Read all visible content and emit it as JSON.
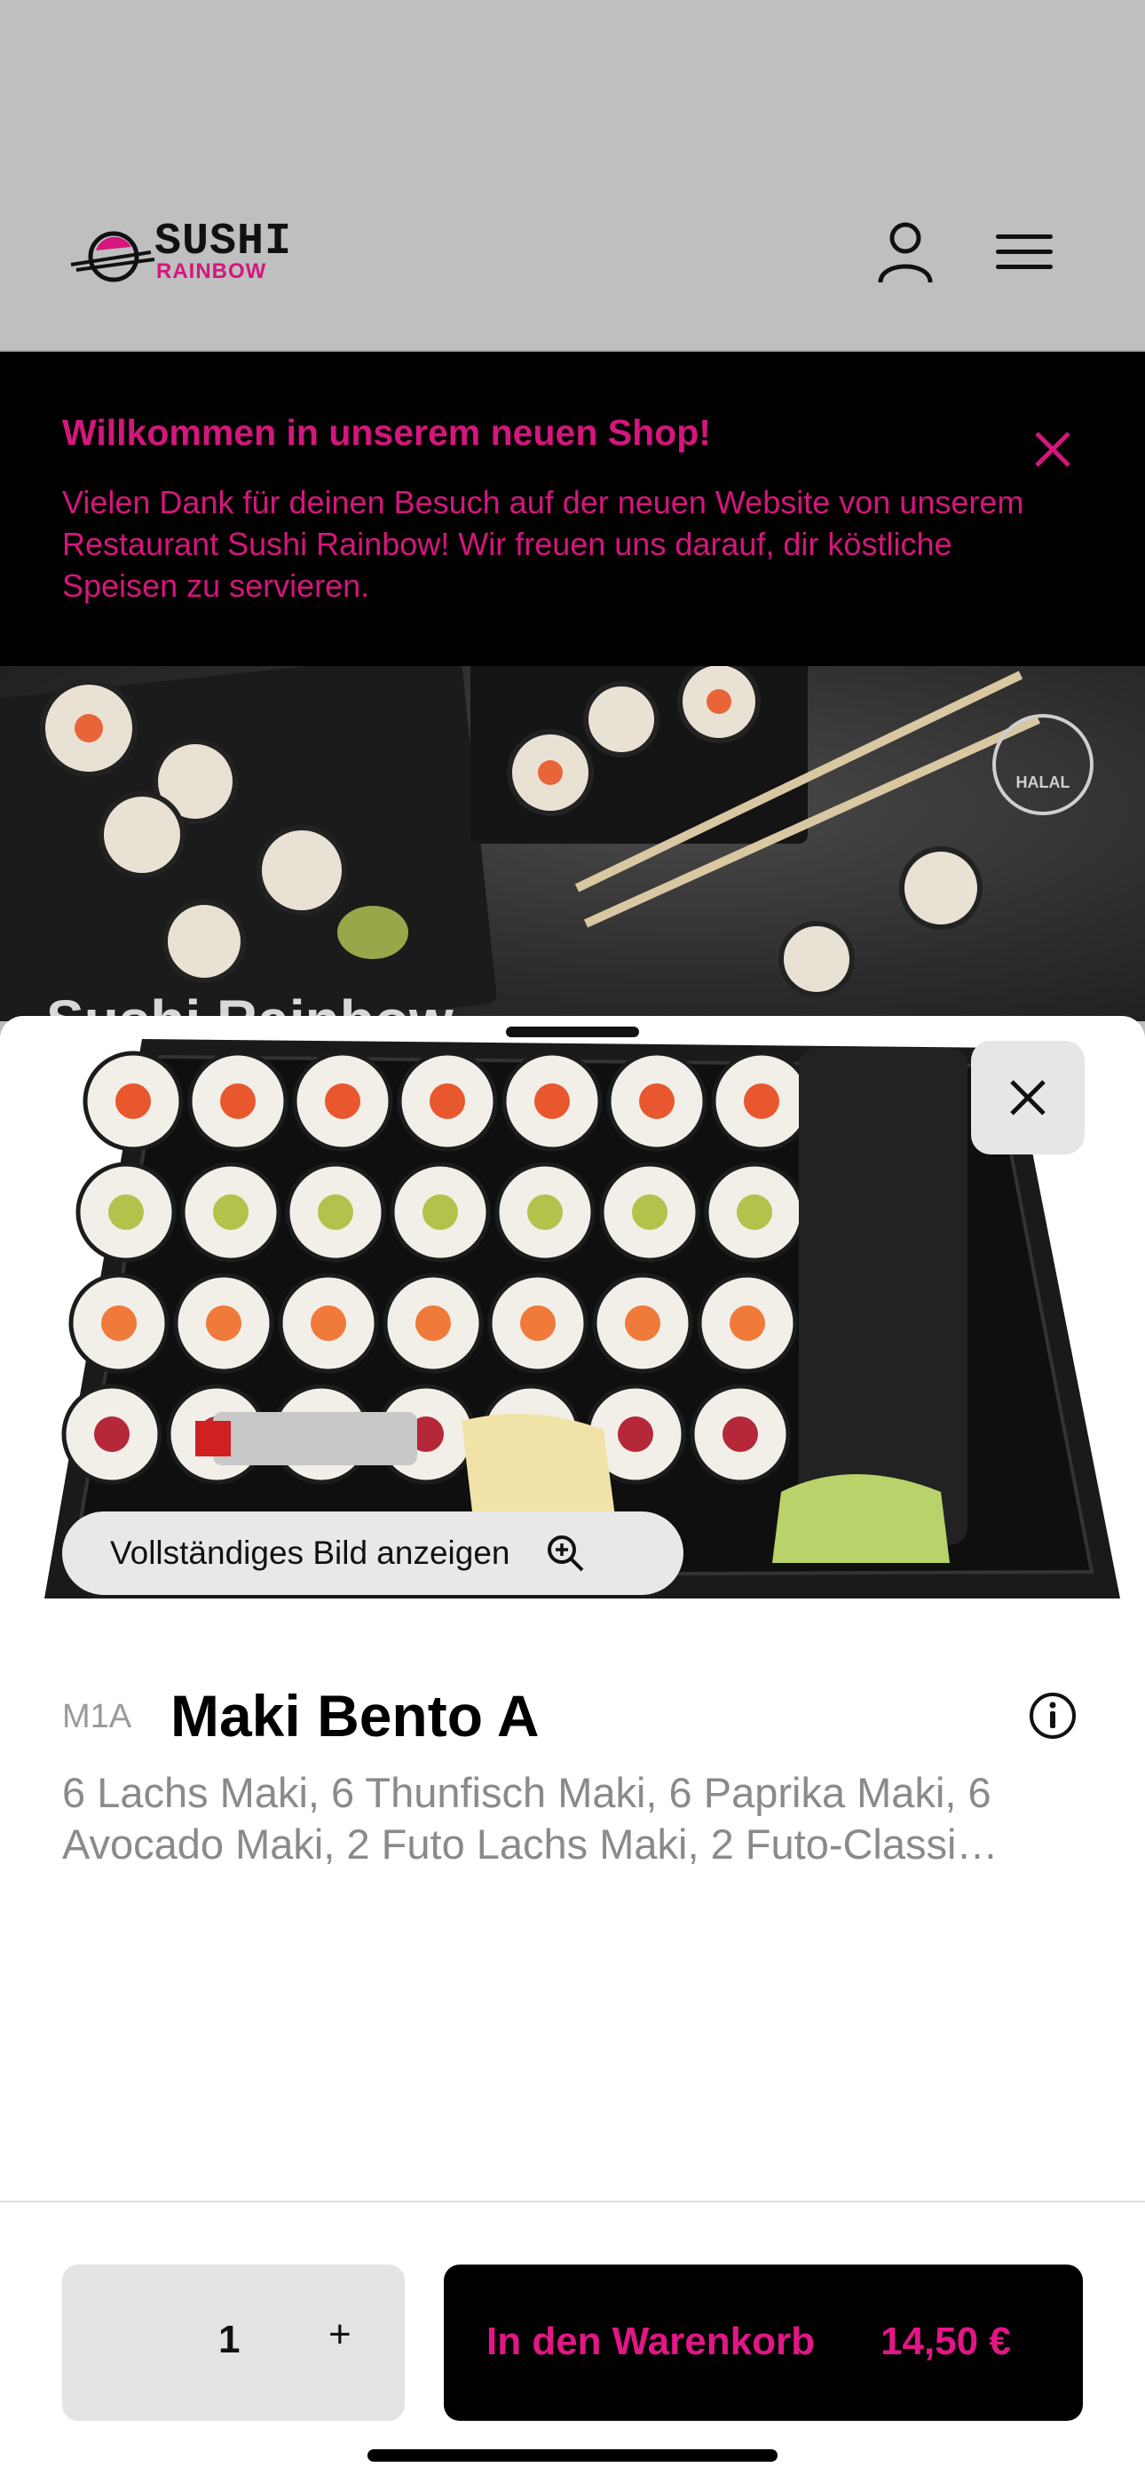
{
  "header": {
    "logo_line1": "SUSHI",
    "logo_line2": "RAINBOW",
    "account_icon": "person-icon",
    "menu_icon": "hamburger-menu-icon"
  },
  "banner": {
    "title": "Willkommen in unserem neuen Shop!",
    "text": "Vielen Dank für deinen Besuch auf der neuen Website von unserem Restaurant Sushi Rainbow! Wir freuen uns darauf, dir köstliche Speisen zu servieren.",
    "close_icon": "close-icon"
  },
  "hero": {
    "title": "Sushi Rainbow",
    "badge": "HALAL"
  },
  "product": {
    "close_icon": "close-icon",
    "full_image_label": "Vollständiges Bild anzeigen",
    "code": "M1A",
    "name": "Maki Bento A",
    "description": "6 Lachs Maki, 6 Thunfisch Maki, 6 Paprika Maki, 6 Avocado Maki, 2 Futo Lachs Maki, 2 Futo-Classi…"
  },
  "footer": {
    "quantity": "1",
    "plus_label": "+",
    "cart_label": "In den Warenkorb",
    "price": "14,50 €"
  },
  "colors": {
    "accent": "#d4167d",
    "cart_text": "#e21686",
    "banner_bg": "#000000",
    "header_bg": "#bfbfbf"
  }
}
